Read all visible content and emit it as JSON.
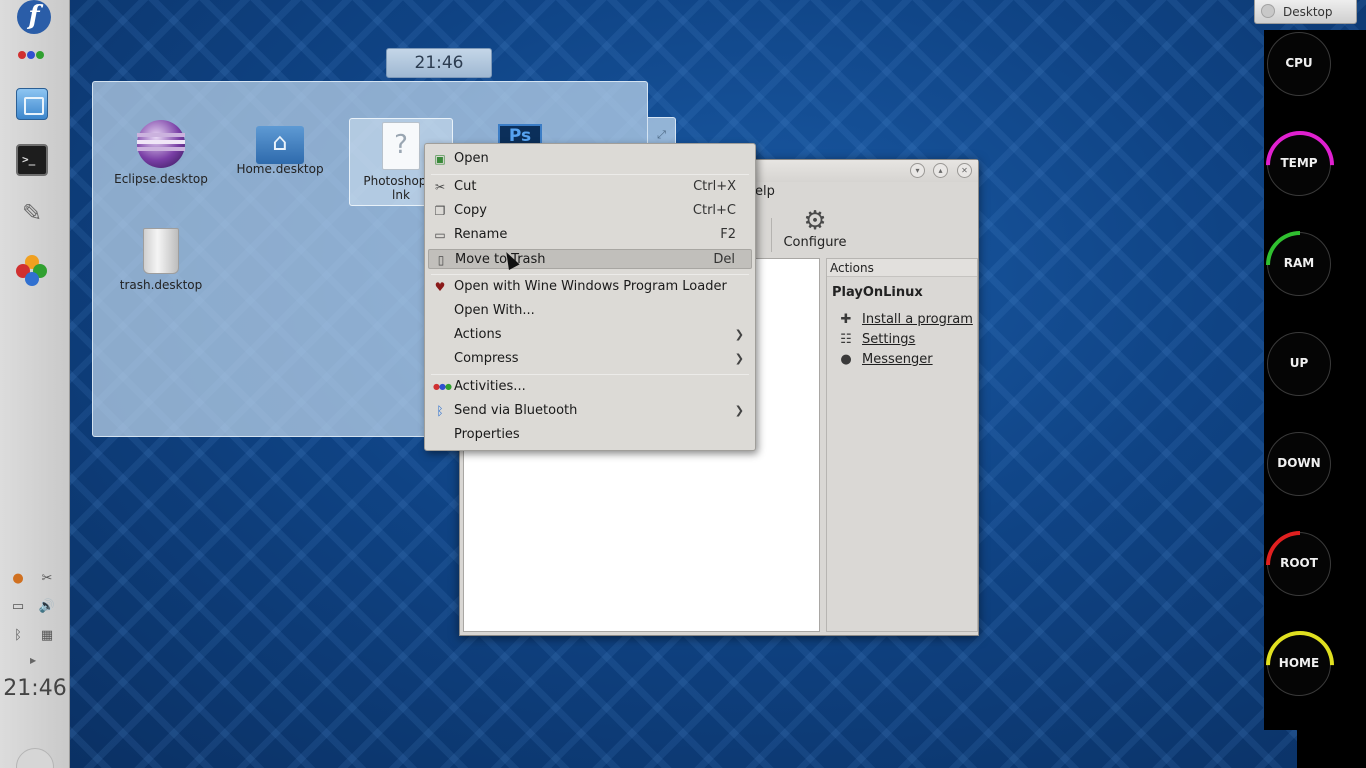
{
  "left_panel": {
    "clock": "21:46",
    "launchers": [
      "fedora-logo",
      "activities",
      "file-manager",
      "terminal",
      "gimp",
      "playonlinux"
    ],
    "tray_icons": [
      "klipper-icon",
      "scissors-icon",
      "keyboard-icon",
      "volume-icon",
      "bluetooth-icon",
      "printer-icon"
    ]
  },
  "folder_view": {
    "clock": "21:46",
    "items": [
      {
        "label": "Eclipse.desktop",
        "icon": "eclipse-icon"
      },
      {
        "label": "Home.desktop",
        "icon": "home-folder-icon"
      },
      {
        "label": "Photoshop C\nlnk",
        "icon": "document-icon"
      },
      {
        "label": "trash.desktop",
        "icon": "trash-icon"
      }
    ],
    "photoshop_icon_text": "Ps"
  },
  "context_menu": {
    "items": [
      {
        "label": "Open",
        "icon": "open-icon",
        "shortcut": ""
      },
      {
        "label": "Cut",
        "icon": "scissors-icon",
        "shortcut": "Ctrl+X"
      },
      {
        "label": "Copy",
        "icon": "copy-icon",
        "shortcut": "Ctrl+C"
      },
      {
        "label": "Rename",
        "icon": "rename-icon",
        "shortcut": "F2"
      },
      {
        "label": "Move to Trash",
        "icon": "trash-icon",
        "shortcut": "Del"
      },
      {
        "label": "Open with Wine Windows Program Loader",
        "icon": "wine-icon",
        "shortcut": ""
      },
      {
        "label": "Open With...",
        "icon": "",
        "shortcut": ""
      },
      {
        "label": "Actions",
        "icon": "",
        "shortcut": ""
      },
      {
        "label": "Compress",
        "icon": "",
        "shortcut": ""
      },
      {
        "label": "Activities...",
        "icon": "activities-icon",
        "shortcut": ""
      },
      {
        "label": "Send via Bluetooth",
        "icon": "bluetooth-icon",
        "shortcut": ""
      },
      {
        "label": "Properties",
        "icon": "",
        "shortcut": ""
      }
    ],
    "highlighted": "Move to Trash"
  },
  "pol_window": {
    "menu_partial": "elp",
    "toolbar": {
      "configure_label": "Configure"
    },
    "actions": {
      "header": "Actions",
      "title": "PlayOnLinux",
      "links": [
        {
          "label": "Install a program",
          "icon": "plus-icon"
        },
        {
          "label": "Settings",
          "icon": "settings-list-icon"
        },
        {
          "label": "Messenger",
          "icon": "chat-bubble-icon"
        }
      ]
    }
  },
  "desktop_tab": {
    "label": "Desktop"
  },
  "system_monitor": {
    "gauges": [
      {
        "label": "CPU",
        "color": "#ffffff",
        "level": 0
      },
      {
        "label": "TEMP",
        "color": "#e020d0",
        "level": 0.45
      },
      {
        "label": "RAM",
        "color": "#30c030",
        "level": 0.06
      },
      {
        "label": "UP",
        "color": "#ffffff",
        "level": 0
      },
      {
        "label": "DOWN",
        "color": "#ffffff",
        "level": 0
      },
      {
        "label": "ROOT",
        "color": "#e02020",
        "level": 0.12
      },
      {
        "label": "HOME",
        "color": "#e0e020",
        "level": 0.35
      }
    ]
  }
}
